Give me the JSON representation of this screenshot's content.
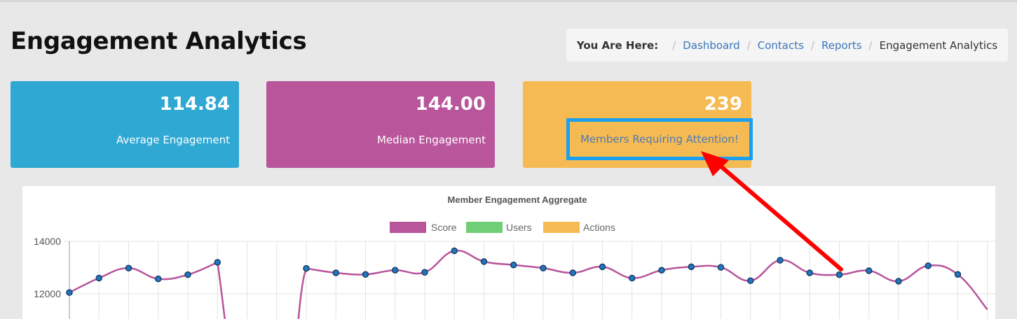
{
  "page_title": "Engagement Analytics",
  "breadcrumb": {
    "label": "You Are Here:",
    "items": [
      "Dashboard",
      "Contacts",
      "Reports"
    ],
    "current": "Engagement Analytics"
  },
  "cards": [
    {
      "value": "114.84",
      "label": "Average Engagement",
      "color": "#2fa8d4"
    },
    {
      "value": "144.00",
      "label": "Median Engagement",
      "color": "#b8559b"
    },
    {
      "value": "239",
      "label": "Members Requiring Attention!",
      "color": "#f5bb52"
    }
  ],
  "annotation": {
    "highlight_color": "#19a0f0",
    "arrow_color": "#ff0000"
  },
  "chart_data": {
    "type": "line",
    "title": "Member Engagement Aggregate",
    "legend_position": "top",
    "grid": true,
    "ylim": [
      11400,
      14000
    ],
    "yticks": [
      14000,
      12000
    ],
    "series": [
      {
        "name": "Score",
        "color": "#b8559b",
        "values": [
          12050,
          12600,
          12980,
          12570,
          12730,
          13200,
          null,
          null,
          12970,
          12800,
          12740,
          12900,
          12820,
          13640,
          13230,
          13100,
          12980,
          12800,
          13030,
          12600,
          12900,
          13030,
          13010,
          12500,
          13280,
          12800,
          12730,
          12880,
          12480,
          13070,
          12740,
          11400
        ]
      },
      {
        "name": "Users",
        "color": "#6fcf76",
        "values": []
      },
      {
        "name": "Actions",
        "color": "#f5bb52",
        "values": []
      }
    ]
  }
}
